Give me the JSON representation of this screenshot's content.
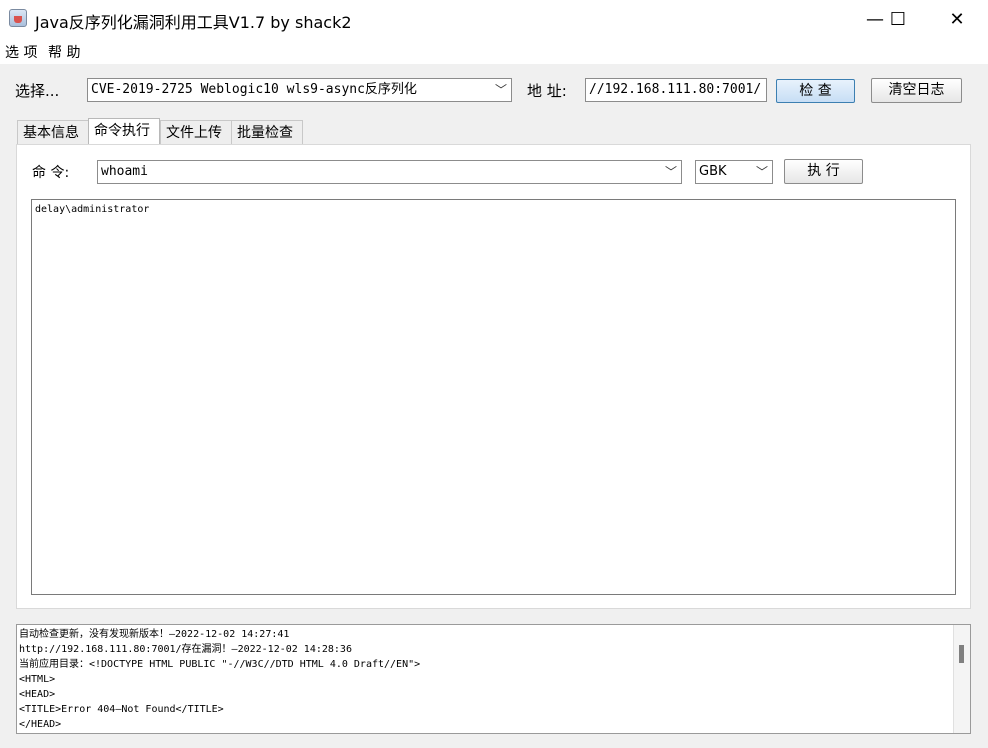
{
  "window": {
    "title": "Java反序列化漏洞利用工具V1.7 by shack2",
    "minimize_glyph": "—",
    "maximize_glyph": "☐",
    "close_glyph": "✕"
  },
  "menu": [
    "选 项",
    "帮 助"
  ],
  "top": {
    "select_label": "选择...",
    "exploit_value": "CVE-2019-2725 Weblogic10 wls9-async反序列化",
    "address_label": "地 址:",
    "address_value": "//192.168.111.80:7001/",
    "check_button": "检 查",
    "clear_log_button": "清空日志"
  },
  "tabs": [
    "基本信息",
    "命令执行",
    "文件上传",
    "批量检查"
  ],
  "active_tab": "命令执行",
  "command": {
    "label": "命 令:",
    "value": "whoami",
    "encoding": "GBK",
    "execute_button": "执 行"
  },
  "output_text": "delay\\administrator",
  "log_lines": [
    "自动检查更新，没有发现新版本！—2022-12-02 14:27:41",
    "http://192.168.111.80:7001/存在漏洞！—2022-12-02 14:28:36",
    "当前应用目录：<!DOCTYPE HTML PUBLIC \"-//W3C//DTD HTML 4.0 Draft//EN\">",
    "<HTML>",
    "<HEAD>",
    "<TITLE>Error 404—Not Found</TITLE>",
    "</HEAD>"
  ],
  "icons": {
    "app": "java-cup-icon",
    "dropdown": "chevron-down-icon"
  }
}
